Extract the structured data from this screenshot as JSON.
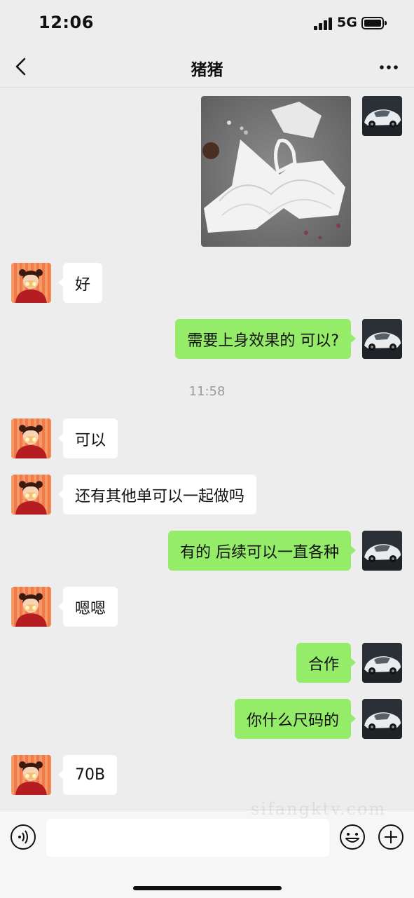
{
  "status_bar": {
    "time": "12:06",
    "network": "5G"
  },
  "header": {
    "title": "猪猪"
  },
  "messages": [
    {
      "side": "right",
      "type": "image",
      "image_icon": "lace-bra-photo"
    },
    {
      "side": "left",
      "text": "好"
    },
    {
      "side": "right",
      "text": "需要上身效果的 可以?"
    },
    {
      "side": "left",
      "text": "可以"
    },
    {
      "side": "left",
      "text": "还有其他单可以一起做吗"
    },
    {
      "side": "right",
      "text": "有的 后续可以一直各种"
    },
    {
      "side": "left",
      "text": "嗯嗯"
    },
    {
      "side": "right",
      "text": "合作"
    },
    {
      "side": "right",
      "text": "你什么尺码的"
    },
    {
      "side": "left",
      "text": "70B"
    }
  ],
  "timestamp": "11:58",
  "input": {
    "value": ""
  },
  "watermark": "sifangktv.com",
  "colors": {
    "outgoing_bubble": "#95ec69",
    "incoming_bubble": "#ffffff",
    "background": "#ededed"
  }
}
